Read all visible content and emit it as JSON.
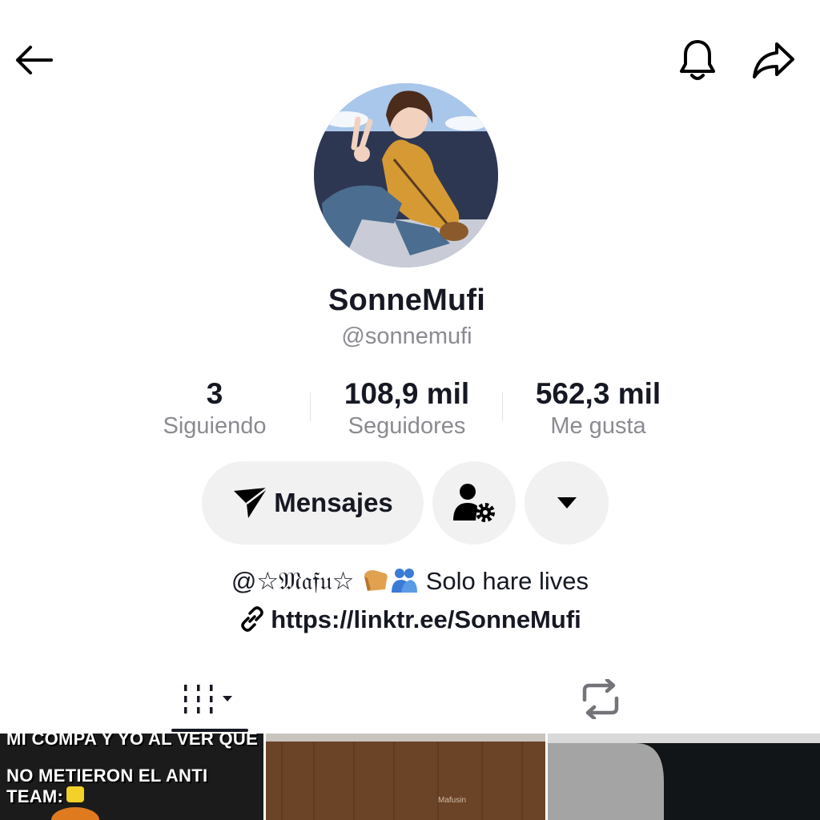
{
  "profile": {
    "display_name": "SonneMufi",
    "handle": "@sonnemufi"
  },
  "stats": {
    "following": {
      "value": "3",
      "label": "Siguiendo"
    },
    "followers": {
      "value": "108,9 mil",
      "label": "Seguidores"
    },
    "likes": {
      "value": "562,3 mil",
      "label": "Me gusta"
    }
  },
  "actions": {
    "message_label": "Mensajes"
  },
  "bio": {
    "mention": "@☆𝔐𝔞𝔣𝔲☆",
    "text": "Solo hare lives",
    "emojis": [
      "bread-emoji",
      "people-hugging-emoji"
    ],
    "link": "https://linktr.ee/SonneMufi"
  },
  "tabs": [
    {
      "name": "videos",
      "icon": "grid-columns-icon",
      "active": true
    },
    {
      "name": "reposts",
      "icon": "repost-icon",
      "active": false
    }
  ],
  "videos": [
    {
      "caption_line1": "MI COMPA Y YO AL VER QUE",
      "caption_line2": "NO METIERON EL ANTI TEAM:"
    },
    {
      "watermark": "Mafusin"
    },
    {}
  ],
  "colors": {
    "text_primary": "#161823",
    "text_secondary": "#8a8b91",
    "button_bg": "#f1f1f2"
  }
}
